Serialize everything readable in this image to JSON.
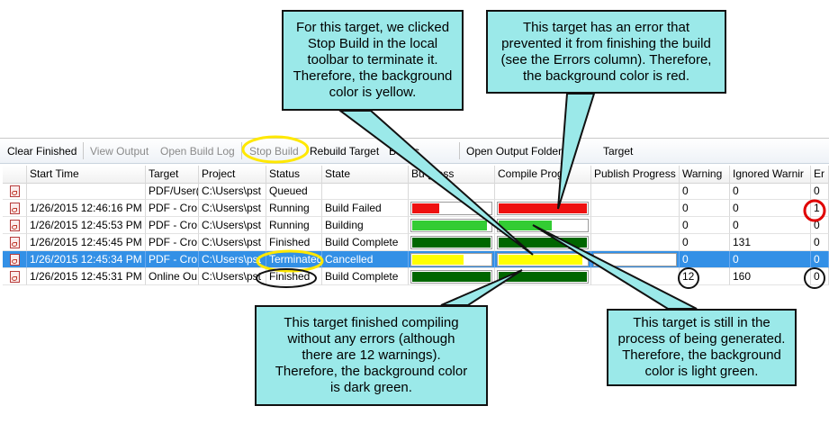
{
  "toolbar": {
    "clear_finished": "Clear Finished",
    "view_output": "View Output",
    "open_build_log": "Open Build Log",
    "stop_build": "Stop Build",
    "rebuild_target": "Rebuild Target",
    "build_targets": "Bu   ets",
    "open_output_folder": "Open Output Folder",
    "target_tail": "Target"
  },
  "columns": [
    "",
    "Start Time",
    "Target",
    "Project",
    "Status",
    "State",
    "Bu   gress",
    "Compile Prog",
    "Publish Progress",
    "Warning",
    "Ignored Warnir",
    "Er"
  ],
  "rows": [
    {
      "icon": "pdf-target-icon",
      "start": "",
      "target": "PDF/User(",
      "project": "C:\\Users\\pst",
      "status": "Queued",
      "state": "",
      "warnings": "0",
      "ignored": "0",
      "errors": "0",
      "build": 0,
      "compile": 0,
      "color": ""
    },
    {
      "icon": "pdf-target-icon",
      "start": "1/26/2015 12:46:16 PM",
      "target": "PDF - Cro",
      "project": "C:\\Users\\pst",
      "status": "Running",
      "state": "Build Failed",
      "warnings": "0",
      "ignored": "0",
      "errors": "1",
      "build": 0.35,
      "compile": 1.0,
      "color": "#ee1111"
    },
    {
      "icon": "pdf-target-icon",
      "start": "1/26/2015 12:45:53 PM",
      "target": "PDF - Cro",
      "project": "C:\\Users\\pst",
      "status": "Running",
      "state": "Building",
      "warnings": "0",
      "ignored": "0",
      "errors": "0",
      "build": 0.95,
      "compile": 0.6,
      "color": "#33cc33"
    },
    {
      "icon": "pdf-target-icon",
      "start": "1/26/2015 12:45:45 PM",
      "target": "PDF - Cro",
      "project": "C:\\Users\\pst",
      "status": "Finished",
      "state": "Build Complete",
      "warnings": "0",
      "ignored": "131",
      "errors": "0",
      "build": 1.0,
      "compile": 1.0,
      "color": "#006600"
    },
    {
      "icon": "pdf-target-icon",
      "start": "1/26/2015 12:45:34 PM",
      "target": "PDF - Cro",
      "project": "C:\\Users\\pst",
      "status": "Terminated",
      "state": "Cancelled",
      "warnings": "0",
      "ignored": "0",
      "errors": "0",
      "build": 0.65,
      "compile": 0.95,
      "color": "#ffff00",
      "selected": true
    },
    {
      "icon": "online-target-icon",
      "start": "1/26/2015 12:45:31 PM",
      "target": "Online Ou",
      "project": "C:\\Users\\pst",
      "status": "Finished",
      "state": "Build Complete",
      "warnings": "12",
      "ignored": "160",
      "errors": "0",
      "build": 1.0,
      "compile": 1.0,
      "color": "#006600"
    }
  ],
  "callouts": {
    "yellow": [
      "For this target, we clicked",
      "Stop Build in the local",
      "toolbar to terminate it.",
      "Therefore, the background",
      "color is yellow."
    ],
    "red": [
      "This target has an error that",
      "prevented it from finishing the build",
      "(see the Errors column). Therefore,",
      "the background color is red."
    ],
    "dark_green": [
      "This target finished compiling",
      "without any errors (although",
      "there are 12 warnings).",
      "Therefore, the background color",
      "is dark green."
    ],
    "light_green": [
      "This target is still in the",
      "process of being generated.",
      "Therefore, the background",
      "color is light green."
    ]
  },
  "colors": {
    "callout_fill": "#9be9e9",
    "selection": "#3390e6",
    "highlight_yellow": "#ffe800",
    "highlight_red": "#e00000"
  }
}
